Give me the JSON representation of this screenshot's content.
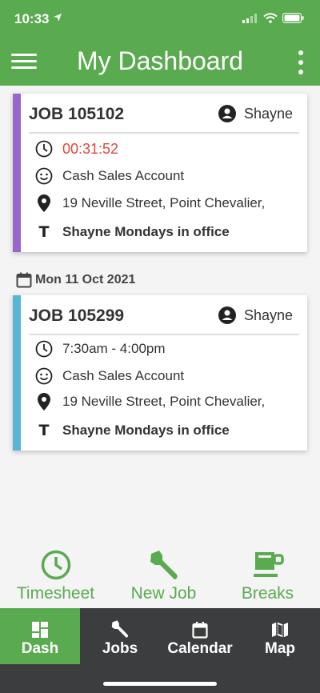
{
  "status": {
    "time": "10:33"
  },
  "header": {
    "title": "My Dashboard"
  },
  "jobs": [
    {
      "job_number": "JOB 105102",
      "assignee": "Shayne",
      "time": "00:31:52",
      "account": "Cash Sales Account",
      "address": "19 Neville Street, Point Chevalier,",
      "note": "Shayne Mondays in office",
      "accent": "#9966cc"
    },
    {
      "job_number": "JOB 105299",
      "assignee": "Shayne",
      "time": "7:30am - 4:00pm",
      "account": "Cash Sales Account",
      "address": "19 Neville Street, Point Chevalier,",
      "note": "Shayne Mondays in office",
      "accent": "#5ab4d8"
    }
  ],
  "date_group": "Mon 11 Oct 2021",
  "quick_actions": [
    {
      "label": "Timesheet",
      "icon": "clock-icon"
    },
    {
      "label": "New Job",
      "icon": "wrench-icon"
    },
    {
      "label": "Breaks",
      "icon": "cup-icon"
    }
  ],
  "tabs": [
    {
      "label": "Dash",
      "icon": "dashboard-icon",
      "active": true
    },
    {
      "label": "Jobs",
      "icon": "wrench-icon"
    },
    {
      "label": "Calendar",
      "icon": "calendar-icon"
    },
    {
      "label": "Map",
      "icon": "map-icon"
    }
  ],
  "colors": {
    "brand": "#5aaa50",
    "nav": "#3c3d3f",
    "timer": "#e0473c"
  }
}
